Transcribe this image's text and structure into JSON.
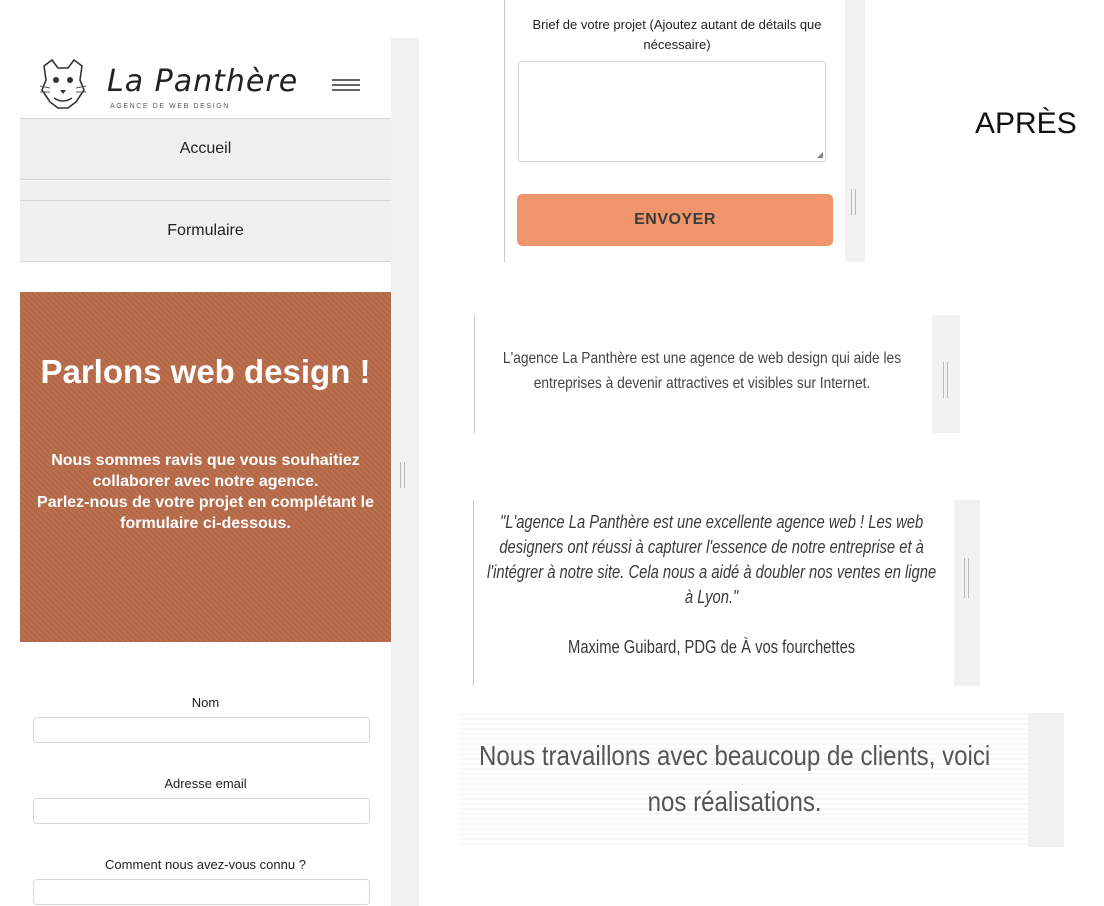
{
  "brand": {
    "name": "La Panthère",
    "tagline": "AGENCE DE WEB DESIGN"
  },
  "nav": {
    "items": [
      {
        "label": "Accueil"
      },
      {
        "label": "Formulaire"
      }
    ]
  },
  "hero": {
    "title": "Parlons web design !",
    "body_line1": "Nous sommes ravis que vous souhaitiez collaborer avec notre agence.",
    "body_line2": "Parlez-nous de votre projet en complétant le formulaire ci-dessous."
  },
  "form": {
    "fields": [
      {
        "label": "Nom",
        "value": ""
      },
      {
        "label": "Adresse email",
        "value": ""
      },
      {
        "label": "Comment nous avez-vous connu ?",
        "value": ""
      }
    ],
    "brief_label": "Brief de votre projet (Ajoutez autant de détails que nécessaire)",
    "brief_value": "",
    "submit_label": "ENVOYER"
  },
  "annotation": {
    "label": "APRÈS"
  },
  "intro": {
    "text": "L'agence La Panthère est une agence de web design qui aide les entreprises à devenir attractives et visibles sur Internet."
  },
  "testimonial": {
    "quote": "\"L'agence La Panthère est une excellente agence web ! Les web designers ont réussi à capturer l'essence de notre entreprise et à l'intégrer à notre site. Cela nous a aidé à doubler nos ventes en ligne à Lyon.\"",
    "author": "Maxime Guibard, PDG de À vos fourchettes"
  },
  "clients": {
    "text": "Nous travaillons avec beaucoup de clients, voici nos réalisations."
  },
  "colors": {
    "hero_bg": "#b86a49",
    "button_bg": "#f0956b",
    "nav_bg": "#efefef"
  }
}
